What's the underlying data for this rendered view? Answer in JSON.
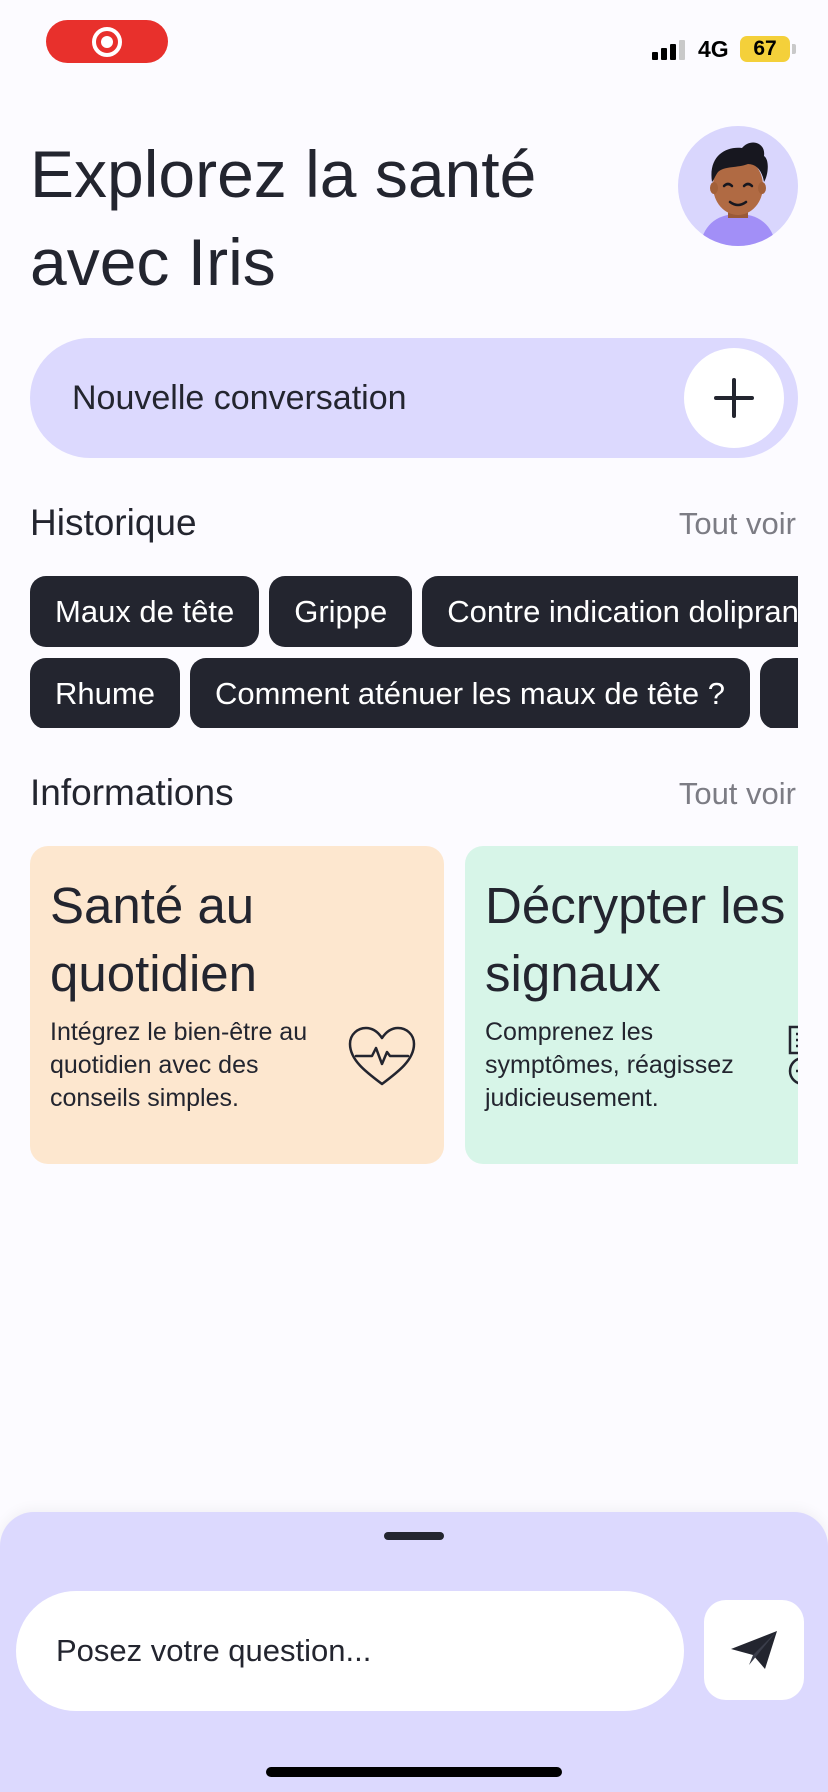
{
  "status_bar": {
    "network": "4G",
    "battery": "67"
  },
  "header": {
    "title": "Explorez la santé avec Iris"
  },
  "new_conversation": {
    "label": "Nouvelle conversation"
  },
  "history": {
    "title": "Historique",
    "see_all": "Tout voir",
    "chips_row1": [
      "Maux de tête",
      "Grippe",
      "Contre indication doliprane"
    ],
    "chips_row2": [
      "Rhume",
      "Comment aténuer les maux de tête ?",
      ""
    ]
  },
  "information": {
    "title": "Informations",
    "see_all": "Tout voir",
    "cards": [
      {
        "title_line1": "Santé au",
        "title_line2": "quotidien",
        "description": "Intégrez le bien-être au quotidien avec des conseils simples.",
        "icon": "heart-pulse-icon",
        "color": "#fde7cf"
      },
      {
        "title_line1": "Décrypter les",
        "title_line2": "signaux",
        "description": "Comprenez les symptômes, réagissez judicieusement.",
        "icon": "signals-icon",
        "color": "#d7f5e8"
      }
    ]
  },
  "composer": {
    "placeholder": "Posez votre question..."
  },
  "colors": {
    "accent": "#dcd9fe",
    "dark": "#23252f",
    "record": "#e8302c",
    "battery": "#f4d03a"
  }
}
